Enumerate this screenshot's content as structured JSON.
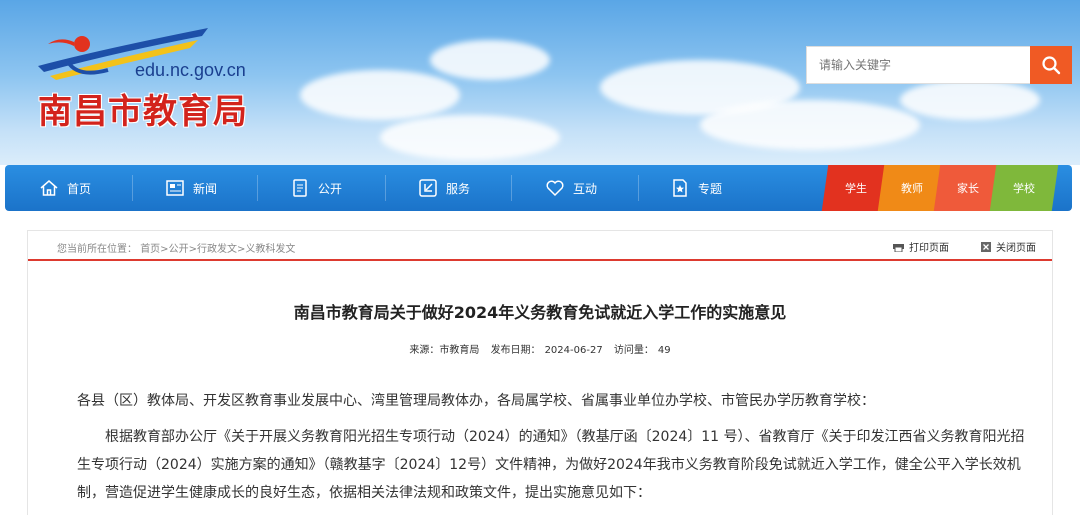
{
  "header": {
    "site_url": "edu.nc.gov.cn",
    "site_title": "南昌市教育局",
    "search_placeholder": "请输入关键字"
  },
  "nav": {
    "items": [
      {
        "label": "首页",
        "icon": "home-icon"
      },
      {
        "label": "新闻",
        "icon": "newspaper-icon"
      },
      {
        "label": "公开",
        "icon": "document-icon"
      },
      {
        "label": "服务",
        "icon": "service-icon"
      },
      {
        "label": "互动",
        "icon": "heart-icon"
      },
      {
        "label": "专题",
        "icon": "star-doc-icon"
      }
    ],
    "quick_links": [
      {
        "label": "学生",
        "color": "#e2321f"
      },
      {
        "label": "教师",
        "color": "#f08a17"
      },
      {
        "label": "家长",
        "color": "#ef5a3a"
      },
      {
        "label": "学校",
        "color": "#7fb83b"
      }
    ]
  },
  "breadcrumb": {
    "prefix": "您当前所在位置：",
    "path": "首页>公开>行政发文>义教科发文"
  },
  "tools": {
    "print": "打印页面",
    "close": "关闭页面"
  },
  "article": {
    "title": "南昌市教育局关于做好2024年义务教育免试就近入学工作的实施意见",
    "source_label": "来源：",
    "source": "市教育局",
    "date_label": "发布日期：",
    "date": "2024-06-27",
    "visits_label": "访问量：",
    "visits": "49",
    "paragraphs": [
      "各县（区）教体局、开发区教育事业发展中心、湾里管理局教体办，各局属学校、省属事业单位办学校、市管民办学历教育学校：",
      "根据教育部办公厅《关于开展义务教育阳光招生专项行动（2024）的通知》（教基厅函〔2024〕11 号）、省教育厅《关于印发江西省义务教育阳光招生专项行动（2024）实施方案的通知》（赣教基字〔2024〕12号）文件精神，为做好2024年我市义务教育阶段免试就近入学工作，健全公平入学长效机制，营造促进学生健康成长的良好生态，依据相关法律法规和政策文件，提出实施意见如下："
    ]
  }
}
